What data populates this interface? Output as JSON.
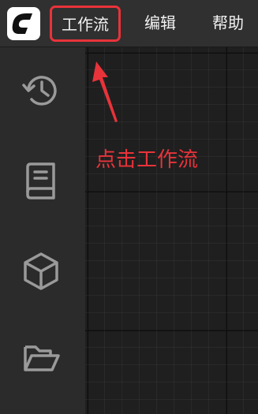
{
  "menubar": {
    "logo_icon": "comfy-logo-icon",
    "items": [
      {
        "label": "工作流",
        "highlighted": true
      },
      {
        "label": "编辑"
      },
      {
        "label": "帮助"
      }
    ]
  },
  "sidebar": {
    "items": [
      {
        "icon": "history-icon"
      },
      {
        "icon": "book-icon"
      },
      {
        "icon": "cube-icon"
      },
      {
        "icon": "folder-open-icon"
      }
    ]
  },
  "annotation": {
    "text": "点击工作流",
    "color": "#e8333a"
  }
}
